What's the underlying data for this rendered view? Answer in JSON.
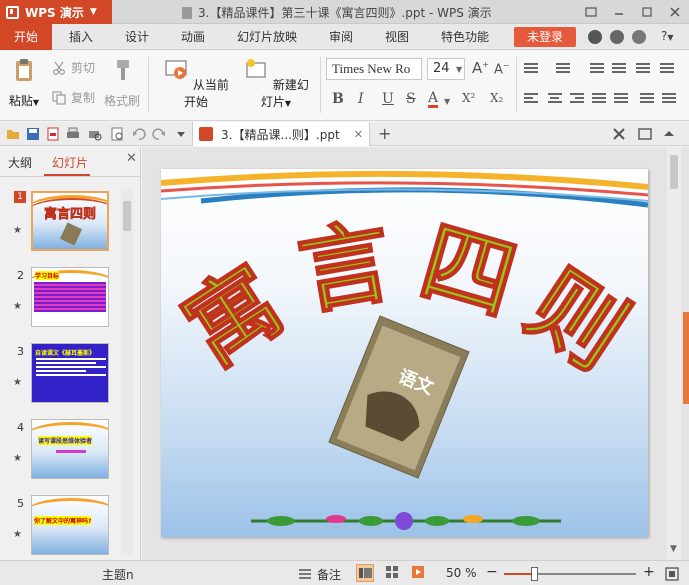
{
  "app": {
    "badge": "WPS 演示",
    "document_title": "3.【精品课件】第三十课《寓言四则》.ppt - WPS 演示"
  },
  "menu": {
    "tabs": [
      "开始",
      "插入",
      "设计",
      "动画",
      "幻灯片放映",
      "审阅",
      "视图",
      "特色功能"
    ],
    "active_tab": "开始",
    "login": "未登录",
    "help": "?"
  },
  "ribbon": {
    "paste": "粘贴",
    "cut": "剪切",
    "copy": "复制",
    "format_painter": "格式刷",
    "play_from_current": "从当前开始",
    "new_slide": "新建幻灯片",
    "font_name": "Times New Ro",
    "font_size": "24",
    "bold": "B",
    "italic": "I",
    "underline": "U",
    "strikethrough": "S",
    "font_color": "A",
    "superscript": "X²",
    "subscript": "X₂"
  },
  "doc_tab": {
    "label": "3.【精品课...则】.ppt",
    "new_tab": "+"
  },
  "left_panel": {
    "tab_outline": "大纲",
    "tab_slides": "幻灯片",
    "close": "✕",
    "slides": [
      {
        "num": "1",
        "title": "寓言四则"
      },
      {
        "num": "2",
        "title": "学习目标"
      },
      {
        "num": "3",
        "title": "自读课文《赫耳墨斯》"
      },
      {
        "num": "4",
        "title": "读写课段思维体验者"
      },
      {
        "num": "5",
        "title": "你了解文中的寓神吗?"
      }
    ]
  },
  "slide": {
    "title": "寓言四则",
    "book_title": "语文"
  },
  "status": {
    "theme": "主题n",
    "notes": "备注",
    "zoom": "50 %",
    "zoom_fraction": 0.23,
    "minus": "−",
    "plus": "+"
  },
  "colors": {
    "brand": "#d24726",
    "title_fill": "#9bc41a",
    "title_stroke": "#c0321e"
  }
}
